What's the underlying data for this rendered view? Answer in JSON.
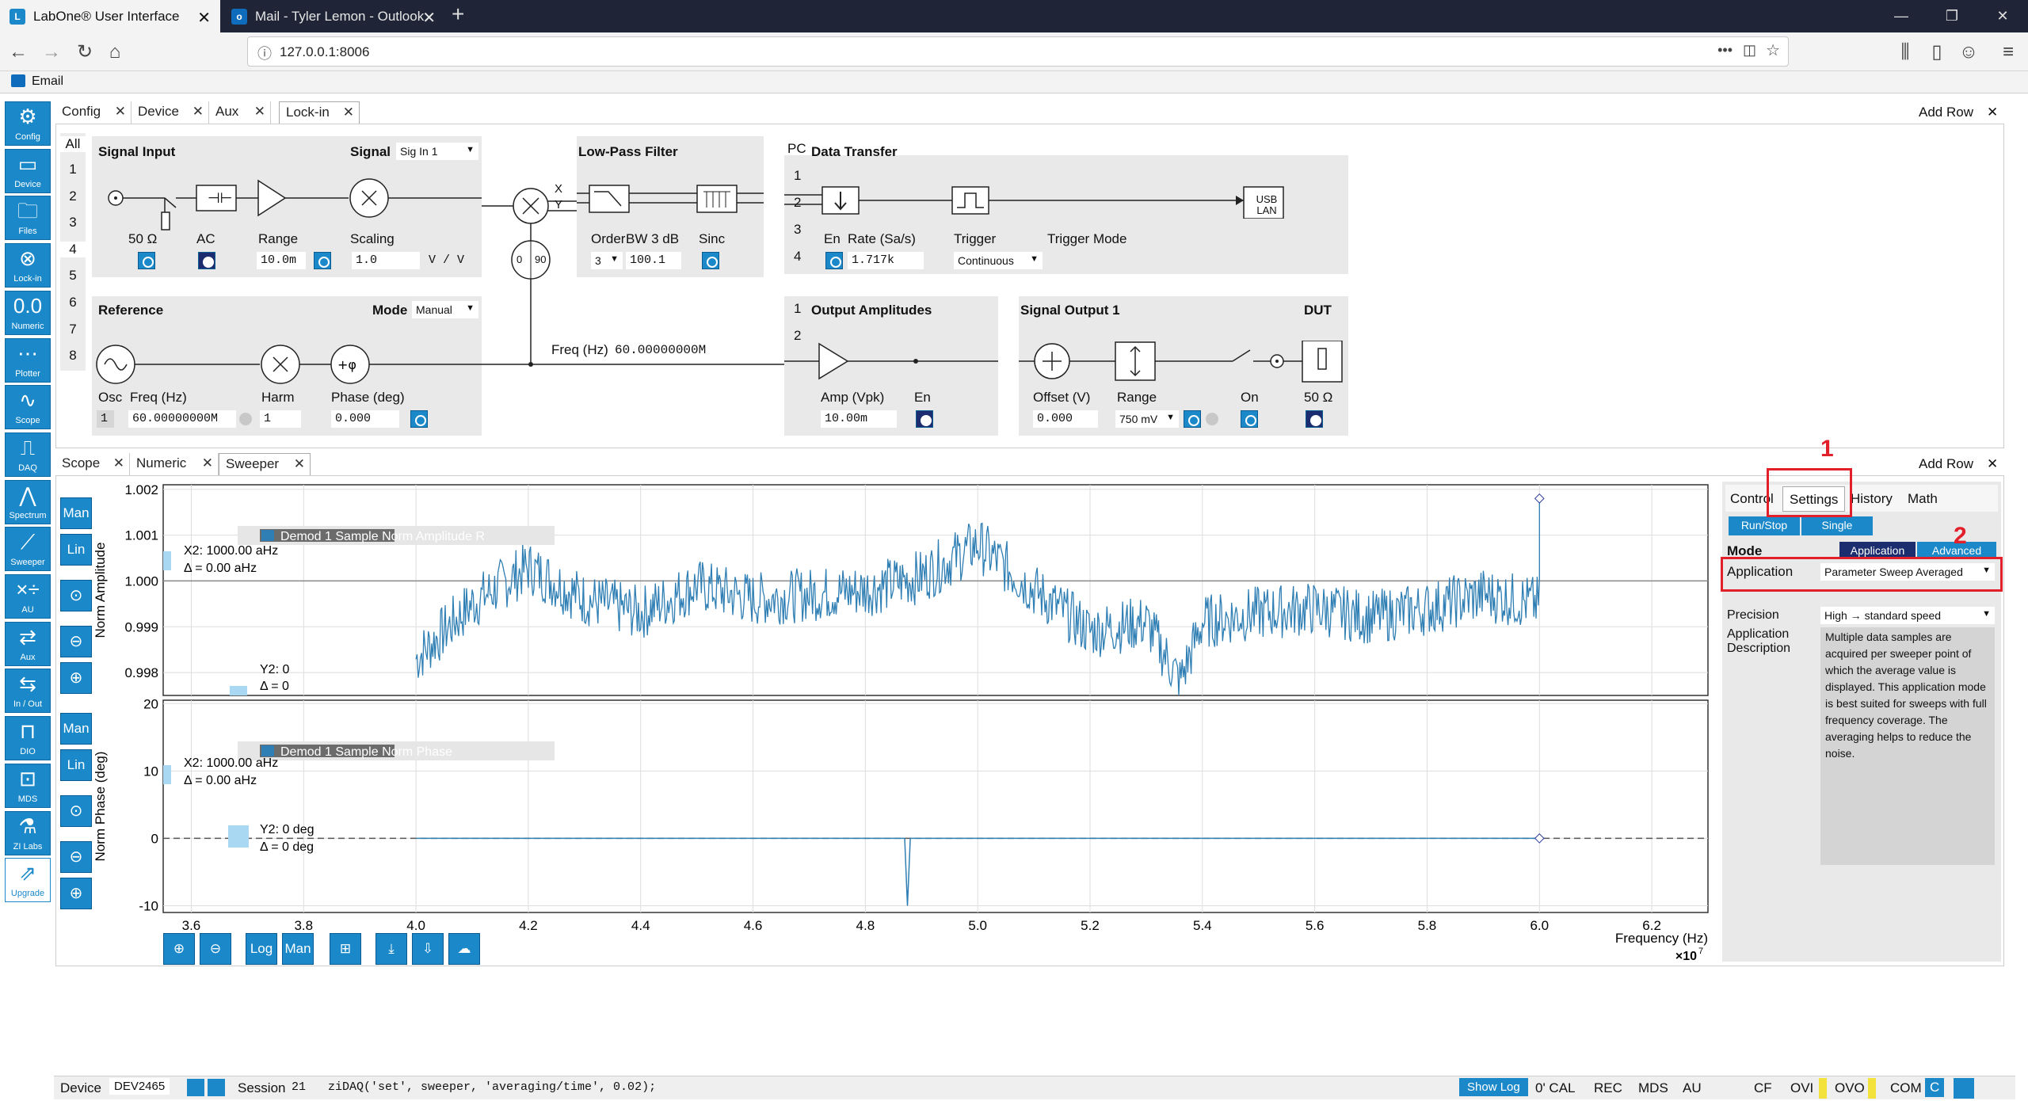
{
  "browser": {
    "tabs": [
      {
        "title": "LabOne® User Interface",
        "active": true
      },
      {
        "title": "Mail - Tyler Lemon - Outlook",
        "active": false
      }
    ],
    "new_tab": "+",
    "url": "127.0.0.1:8006",
    "bookmark": "Email",
    "window_controls": [
      "—",
      "❐",
      "✕"
    ]
  },
  "sidebar": [
    {
      "label": "Config",
      "icon": "gear-icon"
    },
    {
      "label": "Device",
      "icon": "device-icon"
    },
    {
      "label": "Files",
      "icon": "folder-icon"
    },
    {
      "label": "Lock-in",
      "icon": "lockin-icon"
    },
    {
      "label": "Numeric",
      "icon": "numeric-icon"
    },
    {
      "label": "Plotter",
      "icon": "plotter-icon"
    },
    {
      "label": "Scope",
      "icon": "scope-icon"
    },
    {
      "label": "DAQ",
      "icon": "daq-icon"
    },
    {
      "label": "Spectrum",
      "icon": "spectrum-icon"
    },
    {
      "label": "Sweeper",
      "icon": "sweeper-icon"
    },
    {
      "label": "AU",
      "icon": "au-icon"
    },
    {
      "label": "Aux",
      "icon": "aux-icon"
    },
    {
      "label": "In / Out",
      "icon": "inout-icon"
    },
    {
      "label": "DIO",
      "icon": "dio-icon"
    },
    {
      "label": "MDS",
      "icon": "mds-icon"
    },
    {
      "label": "ZI Labs",
      "icon": "flask-icon"
    },
    {
      "label": "Upgrade",
      "icon": "upgrade-icon"
    }
  ],
  "top_tabs": {
    "tabs": [
      "Config",
      "Device",
      "Aux",
      "Lock-in"
    ],
    "active": "Lock-in",
    "add_row": "Add Row"
  },
  "channels": {
    "all": "All",
    "list": [
      "1",
      "2",
      "3",
      "4",
      "5",
      "6",
      "7",
      "8"
    ],
    "selected": "4"
  },
  "lockin": {
    "signal_input": {
      "title": "Signal Input",
      "signal_label": "Signal",
      "signal_value": "Sig In 1",
      "imp": "50 Ω",
      "ac": "AC",
      "range_label": "Range",
      "range_value": "10.0m",
      "scaling_label": "Scaling",
      "scaling_value": "1.0",
      "units": "V / V"
    },
    "lowpass": {
      "title": "Low-Pass Filter",
      "order_label": "Order",
      "order_value": "3",
      "bw_label": "BW 3 dB",
      "bw_value": "100.1",
      "sinc": "Sinc"
    },
    "xy": {
      "x": "X",
      "y": "Y",
      "phase0": "0",
      "phase90": "90"
    },
    "pc_label": "PC",
    "data_transfer": {
      "title": "Data Transfer",
      "channels": [
        "1",
        "2",
        "3",
        "4"
      ],
      "en": "En",
      "rate_label": "Rate (Sa/s)",
      "rate_value": "1.717k",
      "trigger_label": "Trigger",
      "trigger_value": "Continuous",
      "trigger_mode_label": "Trigger Mode",
      "usb1": "USB",
      "usb2": "LAN"
    },
    "reference": {
      "title": "Reference",
      "mode_label": "Mode",
      "mode_value": "Manual",
      "osc_label": "Osc",
      "osc_value": "1",
      "freq_label": "Freq (Hz)",
      "freq_value": "60.00000000M",
      "harm_label": "Harm",
      "harm_value": "1",
      "phase_label": "Phase (deg)",
      "phase_value": "0.000",
      "freq_readout_label": "Freq (Hz)",
      "freq_readout_value": "60.00000000M"
    },
    "output_amplitudes": {
      "title": "Output Amplitudes",
      "channels": [
        "1",
        "2"
      ],
      "amp_label": "Amp (Vpk)",
      "amp_value": "10.00m",
      "en": "En"
    },
    "signal_output": {
      "title": "Signal Output 1",
      "offset_label": "Offset (V)",
      "offset_value": "0.000",
      "range_label": "Range",
      "range_value": "750 mV",
      "on_label": "On"
    },
    "dut": {
      "title": "DUT",
      "imp": "50 Ω"
    }
  },
  "bottom_tabs": {
    "tabs": [
      "Scope",
      "Numeric",
      "Sweeper"
    ],
    "active": "Sweeper",
    "add_row": "Add Row"
  },
  "sweeper_side": {
    "upper_buttons": [
      "Man",
      "Lin"
    ],
    "lower_buttons": [
      "Man",
      "Lin"
    ],
    "bottom_buttons": [
      "Log",
      "Man"
    ]
  },
  "plot": {
    "upper": {
      "ylabel": "Norm Amplitude",
      "yticks": [
        "1.002",
        "1.001",
        "1.000",
        "0.999",
        "0.998"
      ],
      "legend": "Demod 1 Sample Norm Amplitude R",
      "cursor_x2": "X2: 1000.00 aHz",
      "cursor_dx": "Δ = 0.00 aHz",
      "cursor_y2": "Y2: 0",
      "cursor_dy": "Δ = 0"
    },
    "lower": {
      "ylabel": "Norm Phase (deg)",
      "yticks": [
        "20",
        "10",
        "0",
        "-10"
      ],
      "legend": "Demod 1 Sample Norm Phase",
      "cursor_x2": "X2: 1000.00 aHz",
      "cursor_dx": "Δ = 0.00 aHz",
      "cursor_y2": "Y2: 0 deg",
      "cursor_dy": "Δ = 0 deg"
    },
    "xticks": [
      "3.6",
      "3.8",
      "4.0",
      "4.2",
      "4.4",
      "4.6",
      "4.8",
      "5.0",
      "5.2",
      "5.4",
      "5.6",
      "5.8",
      "6.0",
      "6.2"
    ],
    "xlabel": "Frequency (Hz)",
    "xexp": "×10",
    "xexp_sup": "7"
  },
  "settings": {
    "tabs": [
      "Control",
      "Settings",
      "History",
      "Math"
    ],
    "active": "Settings",
    "run_stop": "Run/Stop",
    "single": "Single",
    "mode_label": "Mode",
    "mode_application": "Application",
    "mode_advanced": "Advanced",
    "application_label": "Application",
    "application_value": "Parameter Sweep Averaged",
    "precision_label": "Precision",
    "precision_value": "High → standard speed",
    "desc_label1": "Application",
    "desc_label2": "Description",
    "description": "Multiple data samples are acquired per sweeper point of which the average value is displayed. This application mode is best suited for sweeps with full frequency coverage. The averaging helps to reduce the noise."
  },
  "annotations": {
    "n1": "1",
    "n2": "2"
  },
  "statusbar": {
    "device_label": "Device",
    "device_value": "DEV2465",
    "session_label": "Session",
    "session_value": "21",
    "command": "ziDAQ('set', sweeper, 'averaging/time', 0.02);",
    "show_log": "Show Log",
    "items": [
      "0' CAL",
      "REC",
      "MDS",
      "AU",
      "CF",
      "OVI",
      "OVO",
      "COM",
      "C"
    ]
  },
  "chart_data": [
    {
      "type": "line",
      "title": "",
      "xlabel": "Frequency (Hz)",
      "ylabel": "Norm Amplitude",
      "xscale": "×10^7",
      "xlim": [
        3.55,
        6.3
      ],
      "ylim": [
        0.9975,
        1.002
      ],
      "series": [
        {
          "name": "Demod 1 Sample Norm Amplitude R",
          "x": [
            4.0,
            4.1,
            4.2,
            4.3,
            4.4,
            4.5,
            4.6,
            4.7,
            4.8,
            4.9,
            5.0,
            5.1,
            5.2,
            5.3,
            5.36,
            5.4,
            5.5,
            5.6,
            5.7,
            5.8,
            5.9,
            6.0,
            6.0
          ],
          "y": [
            0.9983,
            0.9995,
            1.0003,
            0.9996,
            0.9993,
            0.9999,
            0.9996,
            0.9997,
            0.9998,
            1.0001,
            1.0008,
            0.9998,
            0.9989,
            0.9991,
            0.9978,
            0.9991,
            0.9993,
            0.9994,
            0.9992,
            0.9994,
            0.9997,
            0.9995,
            1.0018
          ]
        }
      ]
    },
    {
      "type": "line",
      "title": "",
      "xlabel": "Frequency (Hz)",
      "ylabel": "Norm Phase (deg)",
      "xscale": "×10^7",
      "xlim": [
        3.55,
        6.3
      ],
      "ylim": [
        -11,
        20
      ],
      "series": [
        {
          "name": "Demod 1 Sample Norm Phase",
          "x": [
            4.0,
            4.87,
            4.875,
            4.88,
            4.9,
            5.0,
            6.0
          ],
          "y": [
            0,
            0,
            -10,
            0,
            0,
            0,
            0
          ]
        }
      ]
    }
  ]
}
